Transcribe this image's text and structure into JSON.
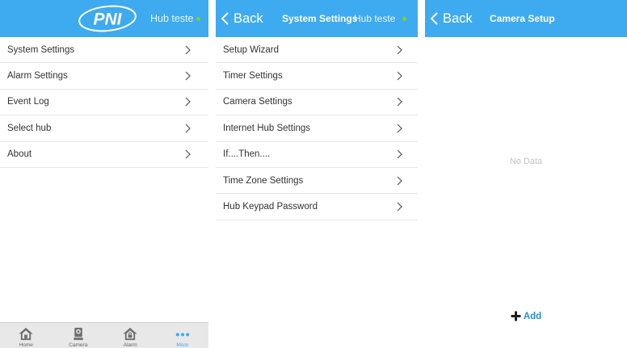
{
  "panel1": {
    "logo_text": "PNI",
    "hub_name": "Hub teste",
    "menu": [
      {
        "label": "System Settings"
      },
      {
        "label": "Alarm Settings"
      },
      {
        "label": "Event Log"
      },
      {
        "label": "Select hub"
      },
      {
        "label": "About"
      }
    ],
    "tabs": [
      {
        "label": "Home",
        "icon": "home-icon"
      },
      {
        "label": "Camera",
        "icon": "camera-icon"
      },
      {
        "label": "Alarm",
        "icon": "alarm-house-icon"
      },
      {
        "label": "More",
        "icon": "more-dots-icon"
      }
    ]
  },
  "panel2": {
    "back_label": "Back",
    "title": "System Settings",
    "hub_name": "Hub teste",
    "menu": [
      {
        "label": "Setup Wizard"
      },
      {
        "label": "Timer Settings"
      },
      {
        "label": "Camera Settings"
      },
      {
        "label": "Internet Hub Settings"
      },
      {
        "label": "If....Then...."
      },
      {
        "label": "Time Zone Settings"
      },
      {
        "label": "Hub Keypad Password"
      }
    ]
  },
  "panel3": {
    "back_label": "Back",
    "title": "Camera Setup",
    "empty_text": "No Data",
    "add_label": "Add"
  },
  "colors": {
    "header_bg": "#3eaaf0",
    "status_dot": "#7ed321",
    "add_accent": "#1f8ee0",
    "tab_active": "#3eaaf0"
  }
}
